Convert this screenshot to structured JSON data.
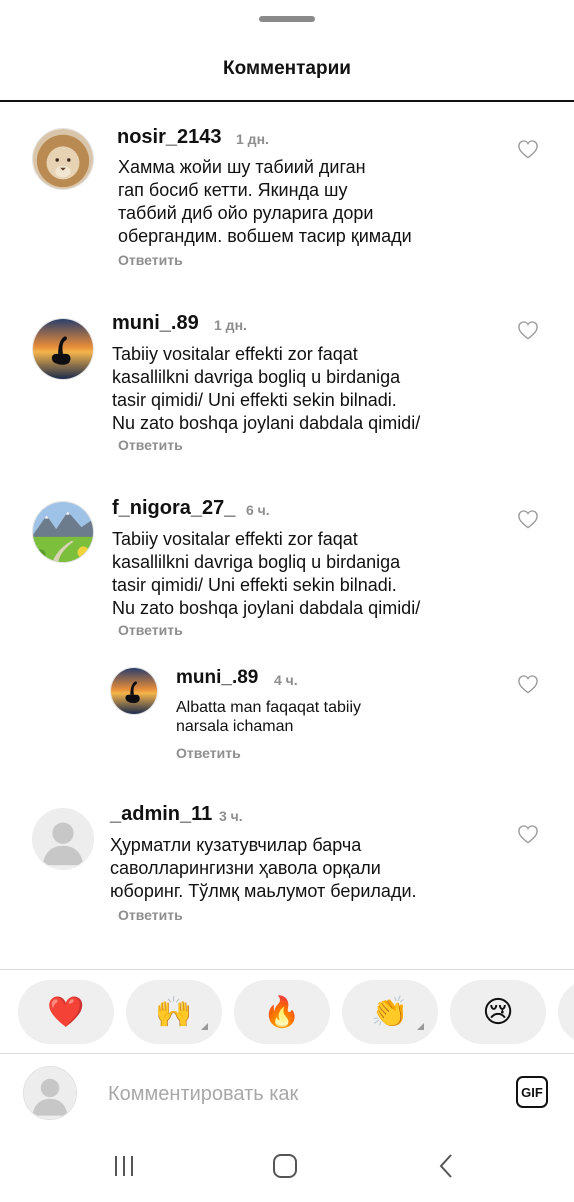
{
  "sheet": {
    "title": "Комментарии"
  },
  "comments": [
    {
      "username": "nosir_2143",
      "time": "1 дн.",
      "text": "Хамма жойи шу табиий диган\nгап босиб кетти. Якинда шу\nтаббий диб ойо руларига дори\nобергандим. вобшем тасир қимади",
      "reply": "Ответить",
      "avatar_icon": "lion-avatar"
    },
    {
      "username": "muni_.89",
      "time": "1 дн.",
      "text": "Tabiiy vositalar effekti zor faqat\nkasallilkni davriga bogliq u birdaniga\ntasir qimidi/ Uni effekti sekin bilnadi.\nNu zato boshqa joylani dabdala qimidi/",
      "reply": "Ответить",
      "avatar_icon": "swan-sunset-avatar"
    },
    {
      "username": "f_nigora_27_",
      "time": "6 ч.",
      "text": "Tabiiy vositalar effekti zor faqat\nkasallilkni davriga bogliq u birdaniga\ntasir qimidi/ Uni effekti sekin bilnadi.\nNu zato boshqa joylani dabdala qimidi/",
      "reply": "Ответить",
      "avatar_icon": "mountain-meadow-avatar"
    },
    {
      "username": "muni_.89",
      "time": "4 ч.",
      "text": "Albatta man faqaqat tabiiy\nnarsala ichaman",
      "reply": "Ответить",
      "avatar_icon": "swan-sunset-avatar",
      "is_reply": true
    },
    {
      "username": "_admin_11",
      "time": "3 ч.",
      "text": "Ҳурматли кузатувчилар барча\nсаволларингизни ҳавола орқали\nюборинг. Тўлмқ маьлумот берилади.",
      "reply": "Ответить",
      "avatar_icon": "default-user-avatar"
    }
  ],
  "reactions": [
    {
      "emoji": "❤️",
      "name": "red-heart"
    },
    {
      "emoji": "🙌",
      "name": "raising-hands",
      "has_variants": true
    },
    {
      "emoji": "🔥",
      "name": "fire"
    },
    {
      "emoji": "👏",
      "name": "clapping-hands",
      "has_variants": true
    },
    {
      "emoji": "😢",
      "name": "crying-face"
    }
  ],
  "composer": {
    "placeholder": "Комментировать как",
    "gif_label": "GIF"
  },
  "colors": {
    "secondary_text": "#8e8e8e",
    "pill_bg": "#efefef",
    "divider": "#dbdbdb"
  }
}
